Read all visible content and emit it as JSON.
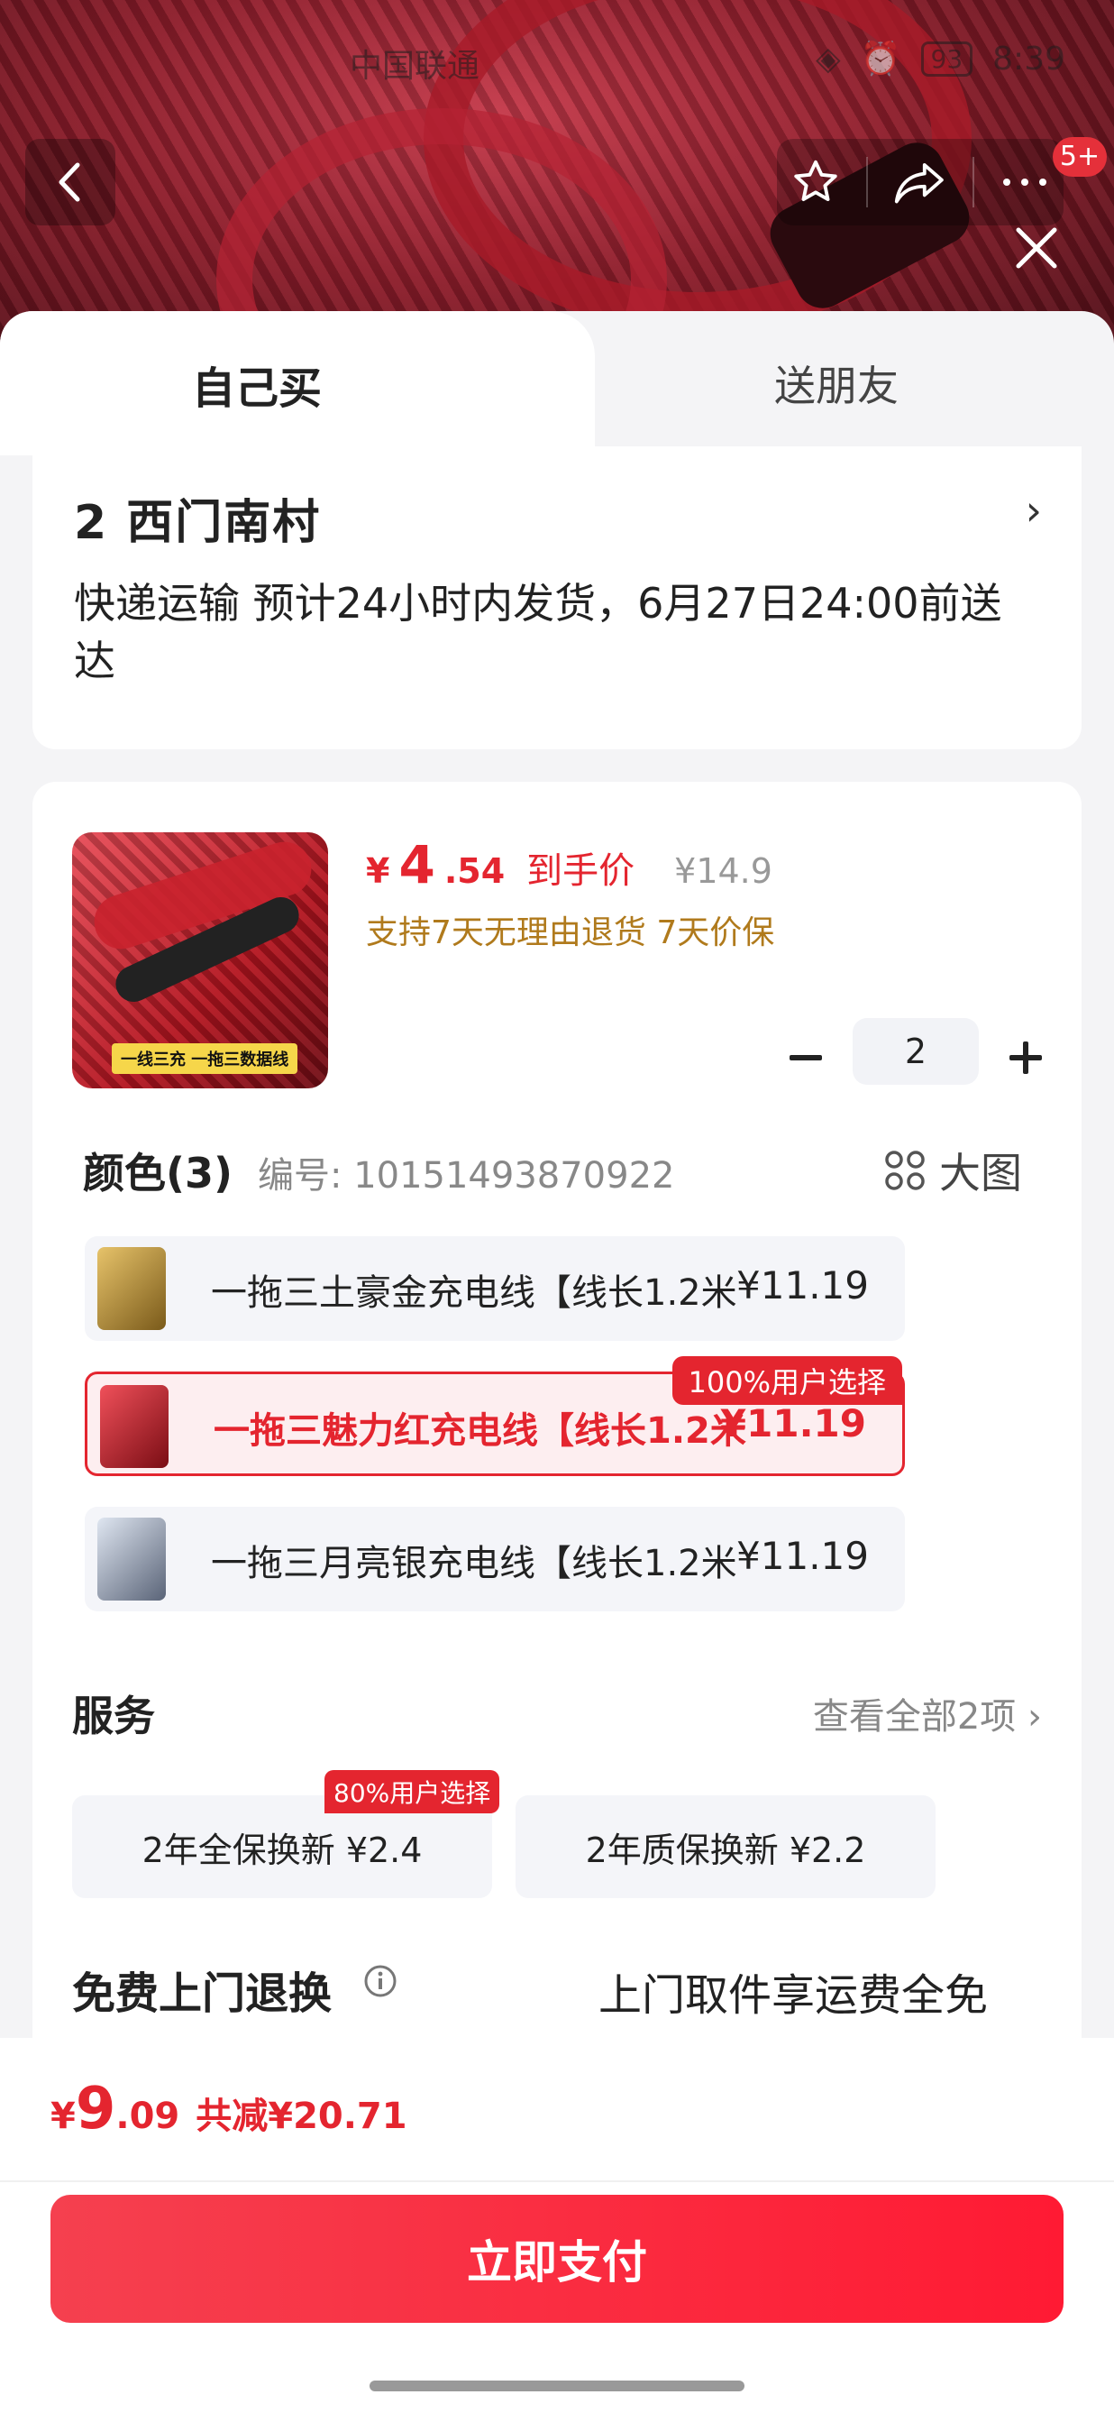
{
  "status_bar": {
    "carrier": "中国联通",
    "battery": "93",
    "time": "8:39"
  },
  "header": {
    "notification_count": "5+"
  },
  "tabs": [
    {
      "label": "自己买",
      "active": true
    },
    {
      "label": "送朋友",
      "active": false
    }
  ],
  "address": {
    "title": "2  西门南村",
    "delivery": "快递运输 预计24小时内发货，6月27日24:00前送达"
  },
  "product": {
    "thumb_banner": "一线三充  一拖三数据线",
    "price_symbol": "¥",
    "price_int": "4",
    "price_dec": ".54",
    "price_tag": "到手价",
    "original_price": "¥14.9",
    "guarantee": "支持7天无理由退货  7天价保",
    "quantity": "2"
  },
  "color_section": {
    "title": "颜色(3)",
    "code": "编号: 10151493870922",
    "big_picture": "大图",
    "options": [
      {
        "label": "一拖三土豪金充电线【线长1.2米",
        "price": "¥11.19",
        "selected": false,
        "swatch": "#c9a24a"
      },
      {
        "label": "一拖三魅力红充电线【线长1.2米",
        "price": "¥11.19",
        "selected": true,
        "swatch": "#c9222d",
        "badge": "100%用户选择"
      },
      {
        "label": "一拖三月亮银充电线【线长1.2米",
        "price": "¥11.19",
        "selected": false,
        "swatch": "#9aa6b8"
      }
    ]
  },
  "services": {
    "title": "服务",
    "view_all": "查看全部2项",
    "items": [
      {
        "label": "2年全保换新  ¥2.4",
        "badge": "80%用户选择"
      },
      {
        "label": "2年质保换新  ¥2.2"
      }
    ]
  },
  "free_return": {
    "title": "免费上门退换",
    "desc": "上门取件享运费全免"
  },
  "footer": {
    "total_symbol": "¥",
    "total_int": "9",
    "total_dec": ".09",
    "saved": "共减¥20.71",
    "pay_label": "立即支付"
  },
  "colors": {
    "accent": "#e4252f",
    "pay_button": "#ff1a33",
    "guarantee": "#b07a1c"
  }
}
